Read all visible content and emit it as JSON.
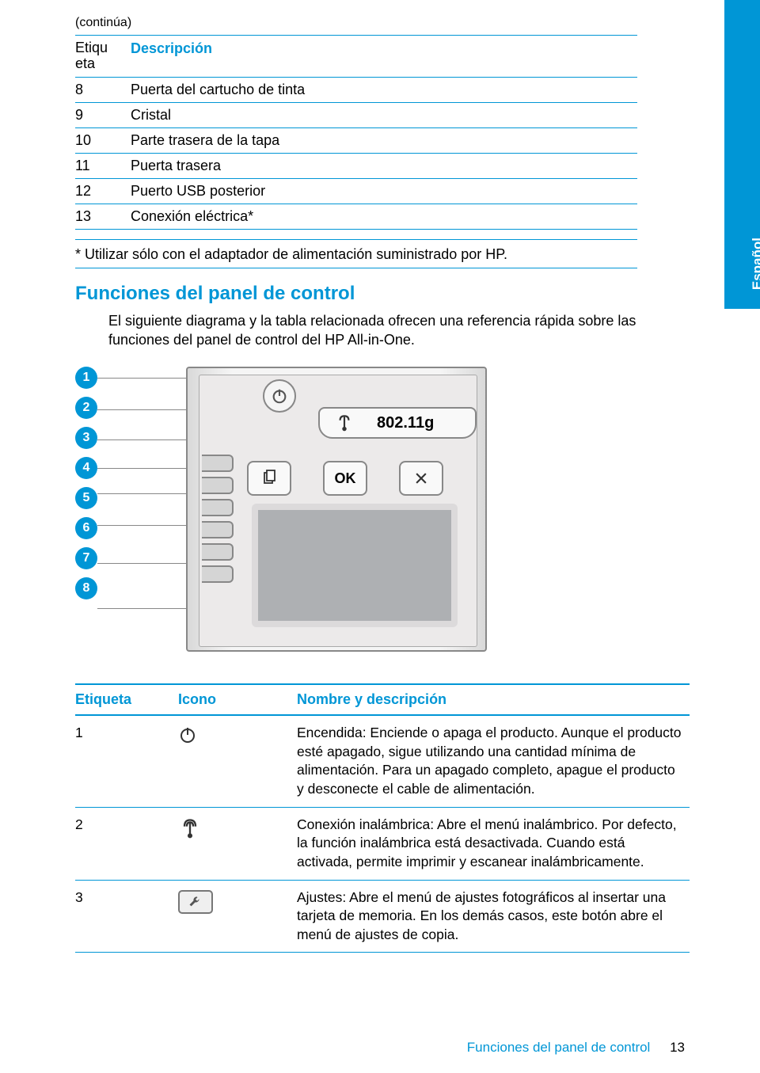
{
  "top": {
    "continua": "(continúa)",
    "headers": {
      "etiqueta": "Etiqu eta",
      "descripcion": "Descripción"
    },
    "rows": [
      {
        "num": "8",
        "desc": "Puerta del cartucho de tinta"
      },
      {
        "num": "9",
        "desc": "Cristal"
      },
      {
        "num": "10",
        "desc": "Parte trasera de la tapa"
      },
      {
        "num": "11",
        "desc": "Puerta trasera"
      },
      {
        "num": "12",
        "desc": "Puerto USB posterior"
      },
      {
        "num": "13",
        "desc": "Conexión eléctrica*"
      }
    ],
    "footnote": "* Utilizar sólo con el adaptador de alimentación suministrado por HP."
  },
  "sidetab": "Español",
  "section": {
    "title": "Funciones del panel de control",
    "intro": "El siguiente diagrama y la tabla relacionada ofrecen una referencia rápida sobre las funciones del panel de control del HP All-in-One."
  },
  "diagram": {
    "callouts": [
      "1",
      "2",
      "3",
      "4",
      "5",
      "6",
      "7",
      "8"
    ],
    "wifi_label": "802.11g",
    "ok_label": "OK"
  },
  "bottom": {
    "headers": {
      "etiqueta": "Etiqueta",
      "icono": "Icono",
      "nombre": "Nombre y descripción"
    },
    "rows": [
      {
        "num": "1",
        "icon": "power",
        "desc": "Encendida: Enciende o apaga el producto. Aunque el producto esté apagado, sigue utilizando una cantidad mínima de alimentación. Para un apagado completo, apague el producto y desconecte el cable de alimentación."
      },
      {
        "num": "2",
        "icon": "wifi",
        "desc": "Conexión inalámbrica: Abre el menú inalámbrico. Por defecto, la función inalámbrica está desactivada. Cuando está activada, permite imprimir y escanear inalámbricamente."
      },
      {
        "num": "3",
        "icon": "wrench",
        "desc": "Ajustes: Abre el menú de ajustes fotográficos al insertar una tarjeta de memoria. En los demás casos, este botón abre el menú de ajustes de copia."
      }
    ]
  },
  "footer": {
    "title": "Funciones del panel de control",
    "page": "13"
  }
}
